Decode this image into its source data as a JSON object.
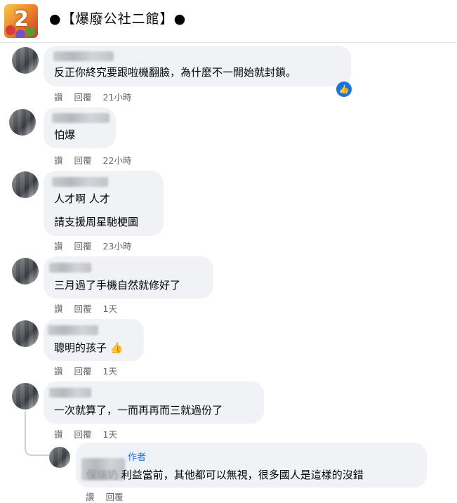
{
  "group": {
    "title": "●【爆廢公社二館】●",
    "logo_text": "2"
  },
  "actions": {
    "like": "讚",
    "reply": "回覆"
  },
  "comments": [
    {
      "text": [
        "反正你終究要跟啦機翻臉，為什麼不一開始就封鎖。"
      ],
      "time": "21小時",
      "has_like": true
    },
    {
      "text": [
        "怕爆"
      ],
      "time": "22小時"
    },
    {
      "text": [
        "人才啊 人才",
        "請支援周星馳梗圖"
      ],
      "time": "23小時"
    },
    {
      "text": [
        "三月過了手機自然就修好了"
      ],
      "time": "1天"
    },
    {
      "text": [
        "聰明的孩子"
      ],
      "time": "1天",
      "emoji": "👍"
    },
    {
      "text": [
        "一次就算了，一而再再而三就過份了"
      ],
      "time": "1天"
    }
  ],
  "reply": {
    "author_badge": "作者",
    "text": "利益當前，其他都可以無視，很多國人是這樣的沒錯",
    "name_fragment": "保瑞奶"
  },
  "icons": {
    "like_badge": "thumbs-up-icon"
  },
  "colors": {
    "accent": "#1b74e4",
    "bubble": "#f0f2f5",
    "meta": "#65676b"
  }
}
